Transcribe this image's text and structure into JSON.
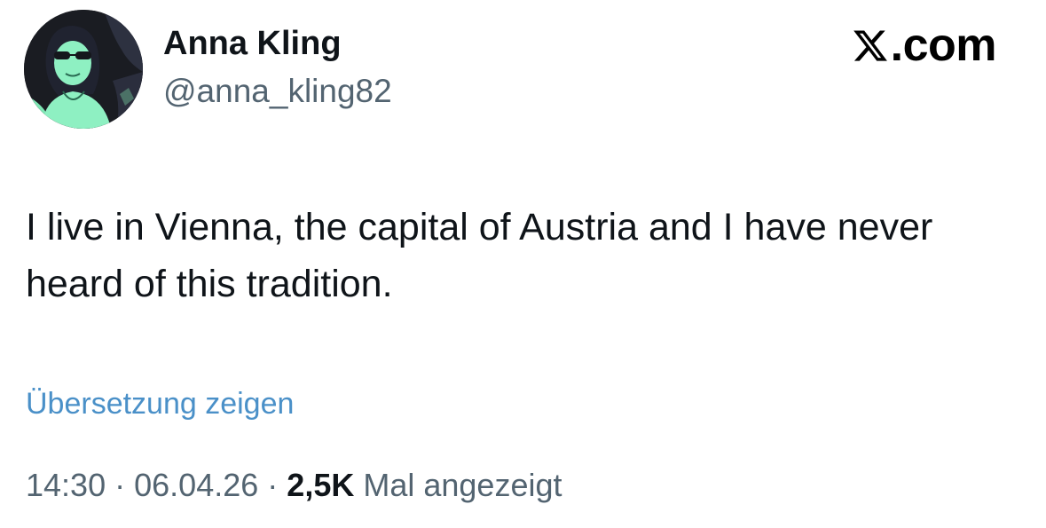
{
  "author": {
    "display_name": "Anna Kling",
    "handle": "@anna_kling82",
    "avatar_icon": "profile-photo-avatar"
  },
  "brand": {
    "icon": "x-logo-icon",
    "text": ".com"
  },
  "tweet": {
    "text": "I live in Vienna, the capital of Austria and I have never heard of this tradition."
  },
  "translate": {
    "label": "Übersetzung zeigen"
  },
  "meta": {
    "time": "14:30",
    "separator": "·",
    "date": "06.04.26",
    "views_count": "2,5K",
    "views_label": "Mal angezeigt"
  },
  "colors": {
    "text": "#0f1419",
    "secondary": "#536471",
    "link": "#4a90c8",
    "avatar_tint": "#8ef0c2"
  }
}
